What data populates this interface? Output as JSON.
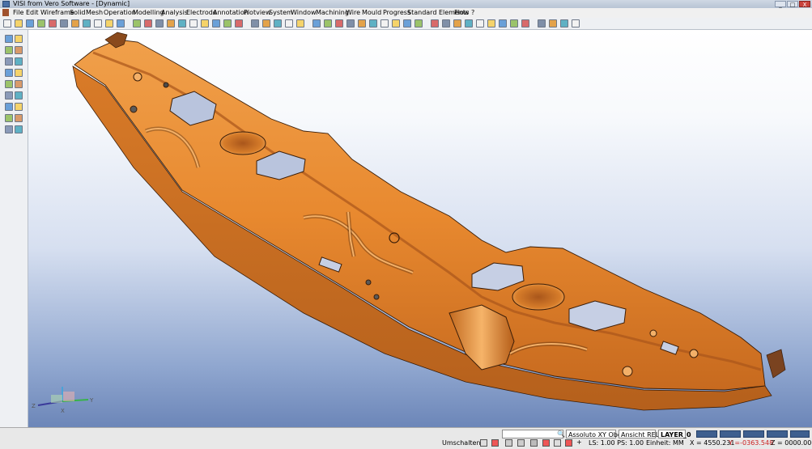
{
  "window": {
    "title": "VISI from Vero Software - [Dynamic]",
    "buttons": [
      "_",
      "□",
      "X"
    ]
  },
  "menu": [
    "File",
    "Edit",
    "Wireframe",
    "Solid",
    "Mesh",
    "Operation",
    "Modelling",
    "Analysis",
    "Electrode",
    "Annotation",
    "Plotview",
    "System",
    "Window",
    "Machining",
    "Wire",
    "Mould",
    "Progress",
    "Standard Elements",
    "Flow",
    "?"
  ],
  "toolbar_icons": [
    "new-file-icon",
    "open-folder-icon",
    "save-icon",
    "print-icon",
    "cut-icon",
    "copy-icon",
    "paste-icon",
    "undo-icon",
    "redo-icon",
    "circle-icon",
    "view-icon",
    "shade-icon",
    "render-icon",
    "wire-icon",
    "hidden-icon",
    "layer-icon",
    "camera-icon",
    "rotate-icon",
    "zoom-icon",
    "zoom-window-icon",
    "pan-icon",
    "fit-icon",
    "front-view-icon",
    "top-view-icon",
    "side-view-icon",
    "iso-view-icon",
    "measure-icon",
    "section-icon",
    "point-icon",
    "line-icon",
    "arc-icon",
    "spline-icon",
    "surface-icon",
    "solid-icon",
    "extrude-icon",
    "revolve-icon",
    "boolean-icon",
    "fillet-icon",
    "chamfer-icon",
    "shell-icon",
    "draft-icon",
    "mirror-icon",
    "pattern-icon",
    "move-icon",
    "scale-icon",
    "delete-icon",
    "attribute-icon",
    "color-icon",
    "help-icon"
  ],
  "left_toolbar_icons": [
    "select-icon",
    "pick-icon",
    "box-select-icon",
    "rotate-view-icon",
    "lasso-icon",
    "point-snap-icon",
    "edge-icon",
    "face-icon",
    "body-icon",
    "curve-icon",
    "section-view-icon",
    "measure-distance-icon",
    "axis-icon",
    "text-icon",
    "filter-icon",
    "layer-icon",
    "arrow-left-icon",
    "arrow-right-icon"
  ],
  "axis": {
    "x": "X",
    "y": "Y",
    "z": "Z"
  },
  "status": {
    "input_placeholder": "",
    "reference_1": "Assoluto XY Obe",
    "reference_2": "Ansicht REL",
    "layer": "LAYER_0",
    "mode": "Umschalten",
    "ls_ps": "LS: 1.00 PS: 1.00",
    "unit": "Einheit: MM",
    "x_coord": "X = 4550.231",
    "y_coord": "Y =-0363.548",
    "z_coord": "Z = 0000.000"
  },
  "colors": {
    "part_fill": "#e8892f",
    "part_shadow": "#a9561b",
    "part_highlight": "#f6b469",
    "edge": "#3a1d08",
    "y_coord_color": "#cc1f1f"
  }
}
